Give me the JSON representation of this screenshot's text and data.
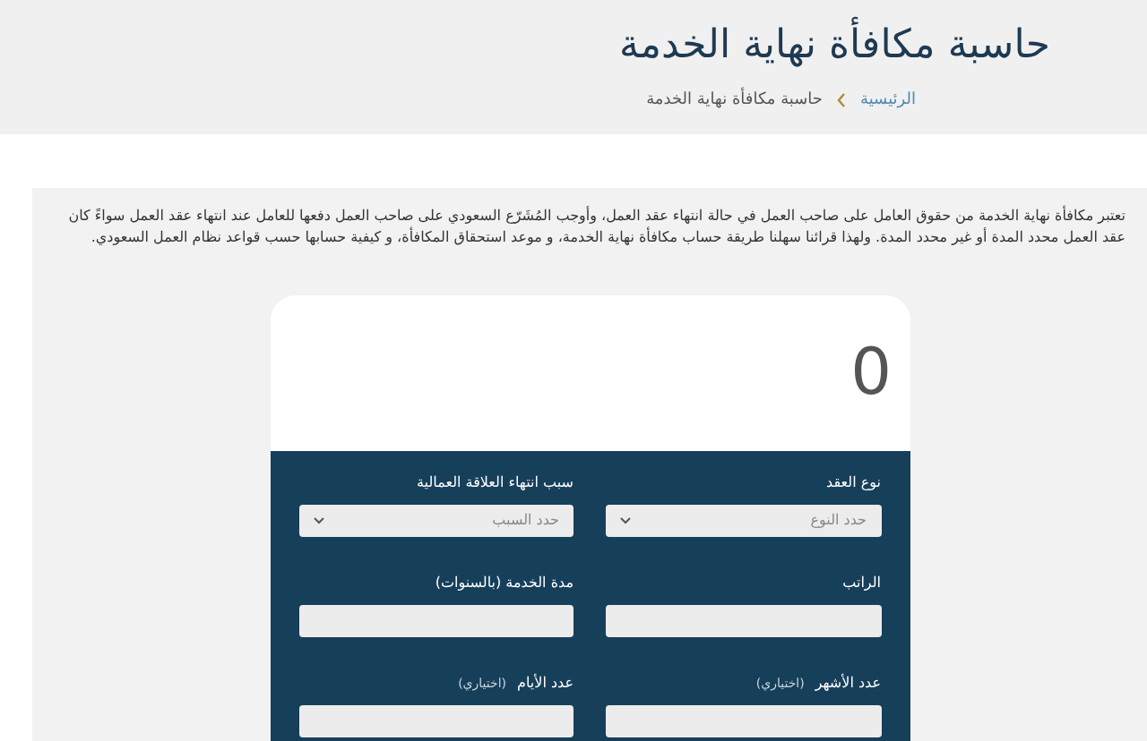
{
  "header": {
    "title": "حاسبة مكافأة نهاية الخدمة",
    "breadcrumb": [
      {
        "label": "الرئيسية",
        "kind": "link"
      },
      {
        "label": "حاسبة مكافأة نهاية الخدمة",
        "kind": "current"
      }
    ]
  },
  "intro": "تعتبر مكافأة نهاية الخدمة من حقوق العامل على صاحب العمل في حالة انتهاء عقد العمل، وأوجب المُشَرّع السعودي على صاحب العمل دفعها للعامل عند انتهاء عقد العمل سواءً كان عقد العمل محدد المدة أو غير محدد المدة. ولهذا قرائنا سهلنا طريقة حساب مكافأة نهاية الخدمة، و موعد استحقاق المكافأة، و كيفية حسابها حسب قواعد نظام العمل السعودي.",
  "calculator": {
    "result": "0",
    "fields": [
      {
        "kind": "select",
        "label": "نوع العقد",
        "value": "حدد النوع"
      },
      {
        "kind": "select",
        "label": "سبب انتهاء العلاقة العمالية",
        "value": "حدد السبب"
      },
      {
        "kind": "input",
        "label": "الراتب"
      },
      {
        "kind": "input",
        "label": "مدة الخدمة (بالسنوات)"
      },
      {
        "kind": "input",
        "label": "عدد الأشهر",
        "hint": "(اختياري)"
      },
      {
        "kind": "input",
        "label": "عدد الأيام",
        "hint": "(اختياري)"
      }
    ]
  }
}
